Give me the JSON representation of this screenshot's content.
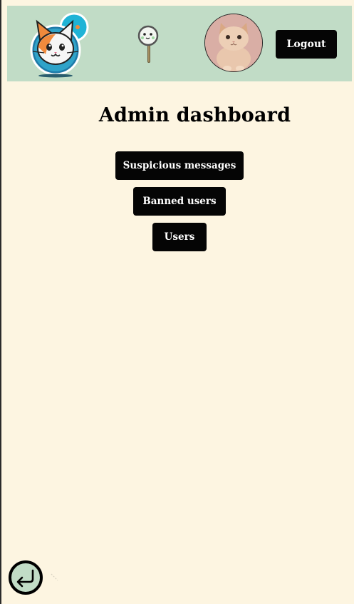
{
  "header": {
    "logo_icon": "cat-chat-logo-icon",
    "search_icon": "magnifier-icon",
    "avatar_icon": "cat-avatar-icon",
    "logout_label": "Logout"
  },
  "main": {
    "title": "Admin dashboard",
    "buttons": [
      {
        "label": "Suspicious messages"
      },
      {
        "label": "Banned users"
      },
      {
        "label": "Users"
      }
    ]
  },
  "footer": {
    "back_icon": "return-arrow-icon"
  },
  "colors": {
    "background": "#fdf5e1",
    "header": "#c1dcc6",
    "button": "#050505",
    "button_text": "#ffffff"
  }
}
